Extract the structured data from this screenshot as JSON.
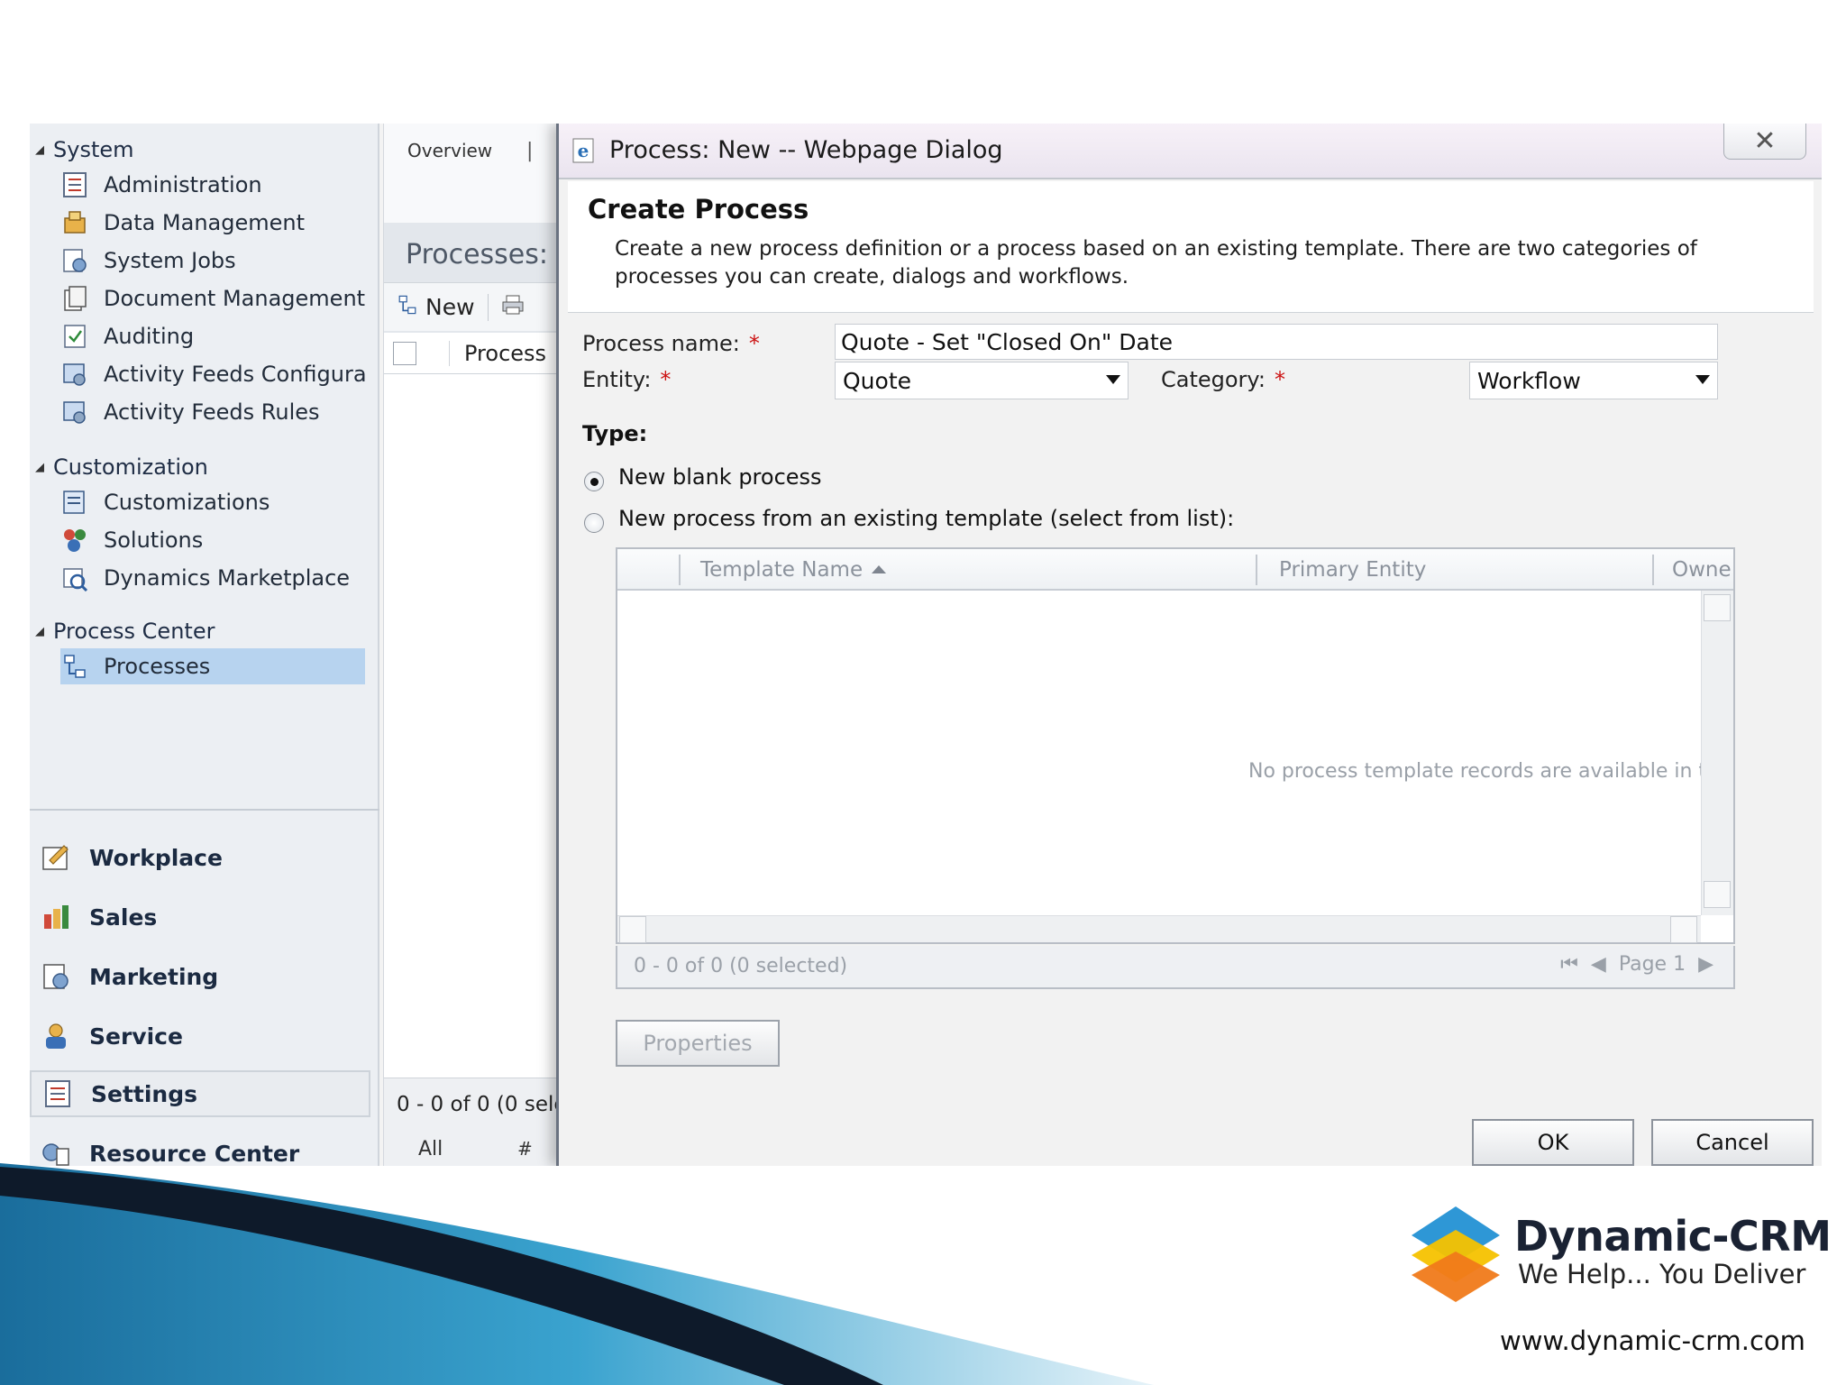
{
  "nav": {
    "groups": [
      {
        "label": "System",
        "items": [
          {
            "label": "Administration",
            "icon": "administration-icon"
          },
          {
            "label": "Data Management",
            "icon": "data-management-icon"
          },
          {
            "label": "System Jobs",
            "icon": "system-jobs-icon"
          },
          {
            "label": "Document Management",
            "icon": "document-icon"
          },
          {
            "label": "Auditing",
            "icon": "auditing-icon"
          },
          {
            "label": "Activity Feeds Configura...",
            "icon": "activity-feeds-icon"
          },
          {
            "label": "Activity Feeds Rules",
            "icon": "activity-feeds-rules-icon"
          }
        ]
      },
      {
        "label": "Customization",
        "items": [
          {
            "label": "Customizations",
            "icon": "customizations-icon"
          },
          {
            "label": "Solutions",
            "icon": "solutions-icon"
          },
          {
            "label": "Dynamics Marketplace",
            "icon": "marketplace-icon"
          }
        ]
      },
      {
        "label": "Process Center",
        "items": [
          {
            "label": "Processes",
            "icon": "processes-icon",
            "selected": true
          }
        ]
      }
    ],
    "workspaces": [
      {
        "label": "Workplace",
        "icon": "workplace-icon"
      },
      {
        "label": "Sales",
        "icon": "sales-icon"
      },
      {
        "label": "Marketing",
        "icon": "marketing-icon"
      },
      {
        "label": "Service",
        "icon": "service-icon"
      },
      {
        "label": "Settings",
        "icon": "settings-icon",
        "selected": true
      },
      {
        "label": "Resource Center",
        "icon": "resource-center-icon"
      }
    ]
  },
  "middle": {
    "tab_overview": "Overview",
    "tab_sep": "|",
    "title": "Processes:",
    "new_button": "New",
    "column": "Process",
    "footer_count": "0 - 0 of 0 (0 sele",
    "footer_all": "All",
    "footer_hash": "#"
  },
  "dialog": {
    "title": "Process: New -- Webpage Dialog",
    "close_glyph": "✕",
    "heading": "Create Process",
    "description": "Create a new process definition or a process based on an existing template. There are two categories of processes you can create, dialogs and workflows.",
    "process_name_label": "Process name:",
    "process_name_value": "Quote - Set \"Closed On\" Date",
    "entity_label": "Entity:",
    "entity_value": "Quote",
    "category_label": "Category:",
    "category_value": "Workflow",
    "required_mark": "*",
    "type_label": "Type:",
    "radio_blank": "New blank process",
    "radio_template": "New process from an existing template (select from list):",
    "selected_type": "blank",
    "grid": {
      "columns": [
        "Template Name",
        "Primary Entity",
        "Owne"
      ],
      "empty_message": "No process template records are available in t",
      "count": "0 - 0 of 0 (0 selected)",
      "page": "Page 1"
    },
    "properties_button": "Properties",
    "ok_button": "OK",
    "cancel_button": "Cancel"
  },
  "brand": {
    "name": "Dynamic-CRM",
    "tagline": "We Help... You Deliver",
    "url": "www.dynamic-crm.com"
  },
  "colors": {
    "nav_selected": "#b7d3ef",
    "required": "#cc1111",
    "swoosh": "#2f8fc0"
  }
}
